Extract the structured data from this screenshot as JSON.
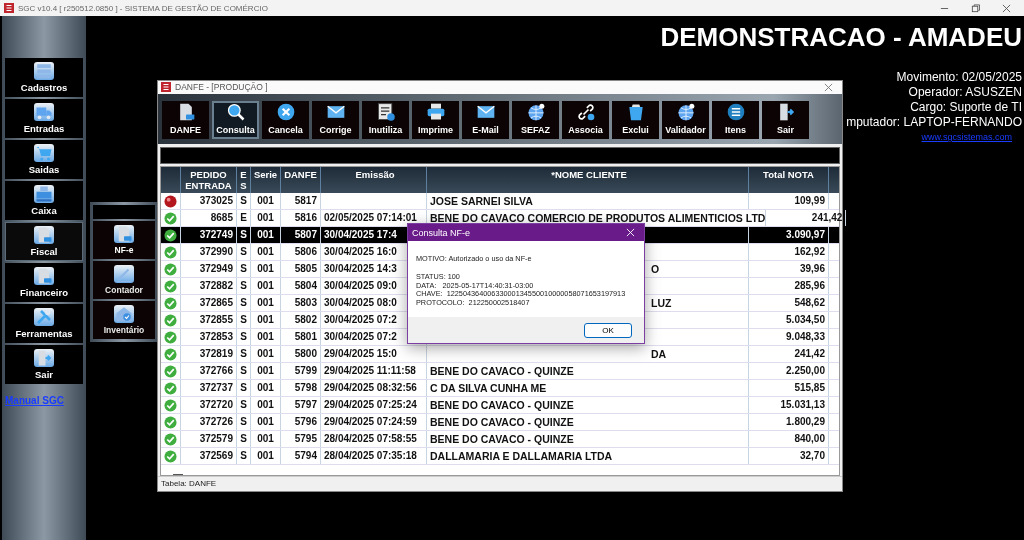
{
  "app": {
    "title": "SGC v10.4 [ r250512.0850 ] - SISTEMA DE GESTÃO DE COMÉRCIO"
  },
  "sidebar": {
    "items": [
      {
        "label": "Cadastros",
        "selected": false
      },
      {
        "label": "Entradas",
        "selected": false
      },
      {
        "label": "Saidas",
        "selected": false
      },
      {
        "label": "Caixa",
        "selected": false
      },
      {
        "label": "Fiscal",
        "selected": true
      },
      {
        "label": "Financeiro",
        "selected": false
      },
      {
        "label": "Ferramentas",
        "selected": false
      },
      {
        "label": "Sair",
        "selected": false
      }
    ],
    "manual_link": "Manual SGC"
  },
  "submenu": {
    "items": [
      {
        "label": "NF-e",
        "selected": true
      },
      {
        "label": "Contador",
        "selected": false
      },
      {
        "label": "Inventário",
        "selected": false
      }
    ]
  },
  "header": {
    "company": "DEMONSTRACAO - AMADEU",
    "lines": [
      "Movimento: 02/05/2025",
      "Operador: ASUSZEN",
      "Cargo: Suporte de TI",
      "mputador: LAPTOP-FERNANDO"
    ],
    "website": "www.sgcsistemas.com"
  },
  "danfe_window": {
    "title": "DANFE - [PRODUÇÃO   ]",
    "toolbar": [
      {
        "label": "DANFE",
        "selected": false
      },
      {
        "label": "Consulta",
        "selected": true
      },
      {
        "label": "Cancela",
        "selected": false
      },
      {
        "label": "Corrige",
        "selected": false
      },
      {
        "label": "Inutiliza",
        "selected": false
      },
      {
        "label": "Imprime",
        "selected": false
      },
      {
        "label": "E-Mail",
        "selected": false
      },
      {
        "label": "SEFAZ",
        "selected": false
      },
      {
        "label": "Associa",
        "selected": false
      },
      {
        "label": "Exclui",
        "selected": false
      },
      {
        "label": "Validador",
        "selected": false
      },
      {
        "label": "Itens",
        "selected": false
      },
      {
        "label": "Sair",
        "selected": false
      }
    ],
    "table": {
      "columns": [
        "PEDIDO ENTRADA",
        "E S",
        "Serie",
        "DANFE",
        "Emissão",
        "*NOME CLIENTE",
        "Total NOTA"
      ],
      "rows": [
        {
          "authorized": false,
          "selected": false,
          "pedido": "373025",
          "es": "S",
          "serie": "001",
          "danfe": "5817",
          "nome": "JOSE SARNEI SILVA",
          "nome_cut": false,
          "total": "109,99"
        },
        {
          "authorized": true,
          "selected": false,
          "pedido": "8685",
          "es": "E",
          "serie": "001",
          "danfe": "5816",
          "emissao": "02/05/2025 07:14:01",
          "nome": "BENE DO CAVACO COMERCIO DE PRODUTOS ALIMENTICIOS LTD",
          "nome_cut": false,
          "total": "241,42"
        },
        {
          "authorized": true,
          "selected": true,
          "pedido": "372749",
          "es": "S",
          "serie": "001",
          "danfe": "5807",
          "emissao": "30/04/2025 17:4",
          "total": "3.090,97"
        },
        {
          "authorized": true,
          "selected": false,
          "pedido": "372990",
          "es": "S",
          "serie": "001",
          "danfe": "5806",
          "emissao": "30/04/2025 16:0",
          "total": "162,92"
        },
        {
          "authorized": true,
          "selected": false,
          "pedido": "372949",
          "es": "S",
          "serie": "001",
          "danfe": "5805",
          "emissao": "30/04/2025 14:3",
          "nome": "O",
          "nome_cut": true,
          "total": "39,96"
        },
        {
          "authorized": true,
          "selected": false,
          "pedido": "372882",
          "es": "S",
          "serie": "001",
          "danfe": "5804",
          "emissao": "30/04/2025 09:0",
          "total": "285,96"
        },
        {
          "authorized": true,
          "selected": false,
          "pedido": "372865",
          "es": "S",
          "serie": "001",
          "danfe": "5803",
          "emissao": "30/04/2025 08:0",
          "nome": "LUZ",
          "nome_cut": true,
          "total": "548,62"
        },
        {
          "authorized": true,
          "selected": false,
          "pedido": "372855",
          "es": "S",
          "serie": "001",
          "danfe": "5802",
          "emissao": "30/04/2025 07:2",
          "total": "5.034,50"
        },
        {
          "authorized": true,
          "selected": false,
          "pedido": "372853",
          "es": "S",
          "serie": "001",
          "danfe": "5801",
          "emissao": "30/04/2025 07:2",
          "total": "9.048,33"
        },
        {
          "authorized": true,
          "selected": false,
          "pedido": "372819",
          "es": "S",
          "serie": "001",
          "danfe": "5800",
          "emissao": "29/04/2025 15:0",
          "nome": "DA",
          "nome_cut": true,
          "total": "241,42"
        },
        {
          "authorized": true,
          "selected": false,
          "pedido": "372766",
          "es": "S",
          "serie": "001",
          "danfe": "5799",
          "emissao": "29/04/2025 11:11:58",
          "nome": "BENE DO CAVACO - QUINZE",
          "nome_cut": false,
          "total": "2.250,00"
        },
        {
          "authorized": true,
          "selected": false,
          "pedido": "372737",
          "es": "S",
          "serie": "001",
          "danfe": "5798",
          "emissao": "29/04/2025 08:32:56",
          "nome": "C DA SILVA CUNHA ME",
          "nome_cut": false,
          "total": "515,85"
        },
        {
          "authorized": true,
          "selected": false,
          "pedido": "372720",
          "es": "S",
          "serie": "001",
          "danfe": "5797",
          "emissao": "29/04/2025 07:25:24",
          "nome": "BENE DO CAVACO - QUINZE",
          "nome_cut": false,
          "total": "15.031,13"
        },
        {
          "authorized": true,
          "selected": false,
          "pedido": "372726",
          "es": "S",
          "serie": "001",
          "danfe": "5796",
          "emissao": "29/04/2025 07:24:59",
          "nome": "BENE DO CAVACO - QUINZE",
          "nome_cut": false,
          "total": "1.800,29"
        },
        {
          "authorized": true,
          "selected": false,
          "pedido": "372579",
          "es": "S",
          "serie": "001",
          "danfe": "5795",
          "emissao": "28/04/2025 07:58:55",
          "nome": "BENE DO CAVACO - QUINZE",
          "nome_cut": false,
          "total": "840,00"
        },
        {
          "authorized": true,
          "selected": false,
          "pedido": "372569",
          "es": "S",
          "serie": "001",
          "danfe": "5794",
          "emissao": "28/04/2025 07:35:18",
          "nome": "DALLAMARIA E DALLAMARIA LTDA",
          "nome_cut": false,
          "total": "32,70"
        }
      ]
    },
    "status_bar": "Tabela: DANFE"
  },
  "dialog": {
    "title": "Consulta NF-e",
    "motivo": "MOTIVO: Autorizado o uso da NF-e",
    "lines": [
      "STATUS: 100",
      "DATA:   2025-05-17T14:40:31-03:00",
      "CHAVE:  12250436400633000134550010000058071653197913",
      "PROTOCOLO:  212250002518407"
    ],
    "button": "OK"
  }
}
